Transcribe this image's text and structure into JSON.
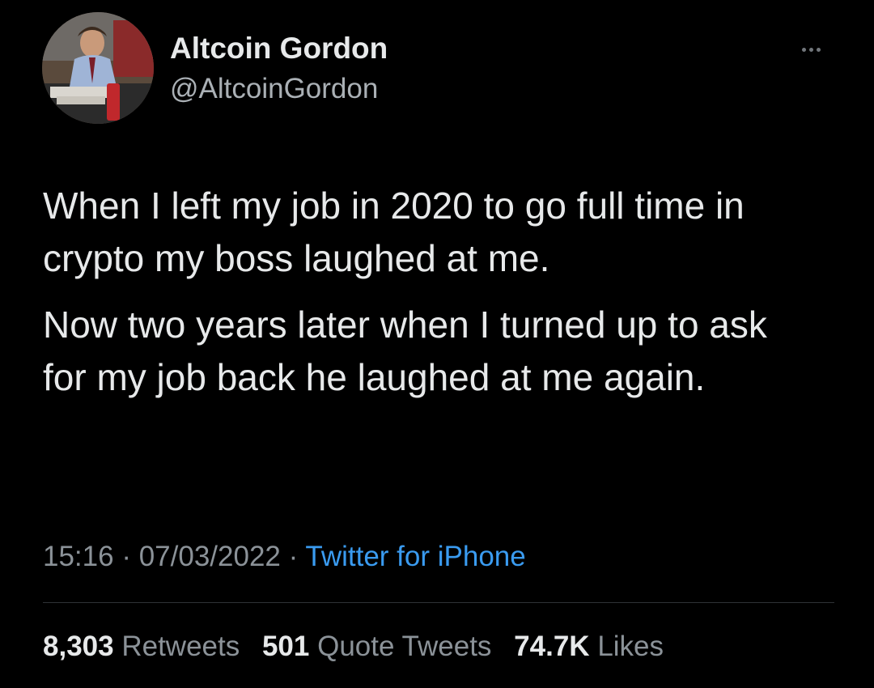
{
  "author": {
    "display_name": "Altcoin Gordon",
    "handle": "@AltcoinGordon"
  },
  "tweet": {
    "paragraphs": [
      "When I left my job in 2020 to go full time in crypto my boss laughed at me.",
      "Now two years later when I turned up to ask for my job back he laughed at me again."
    ]
  },
  "meta": {
    "time": "15:16",
    "separator": "·",
    "date": "07/03/2022",
    "source": "Twitter for iPhone"
  },
  "stats": {
    "retweets_count": "8,303",
    "retweets_label": "Retweets",
    "quotes_count": "501",
    "quotes_label": "Quote Tweets",
    "likes_count": "74.7K",
    "likes_label": "Likes"
  },
  "icons": {
    "more": "more-horizontal-icon"
  },
  "colors": {
    "background": "#000000",
    "primary_text": "#e7e9ea",
    "secondary_text": "#8b9298",
    "link": "#3a9bf0",
    "divider": "#2f3336"
  }
}
